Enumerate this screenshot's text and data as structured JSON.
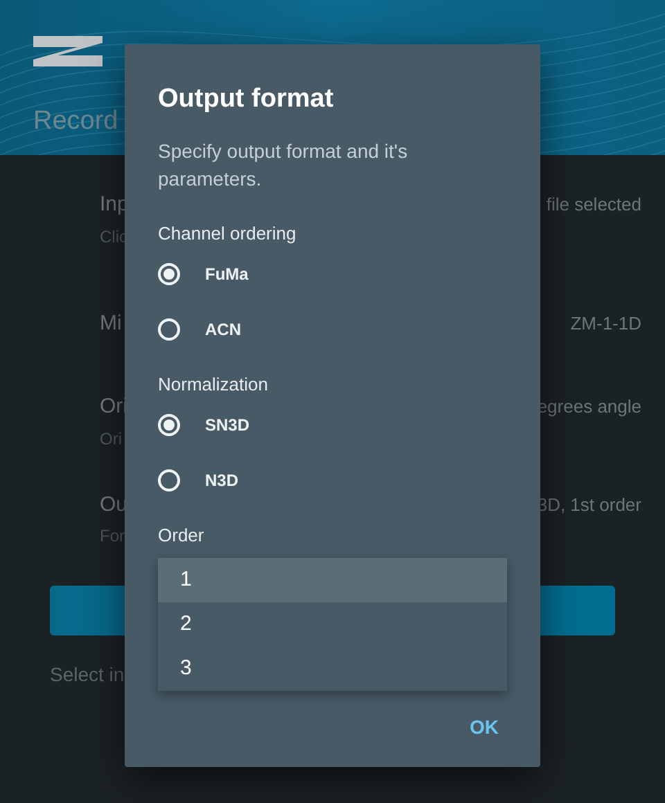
{
  "header": {
    "title": "Record"
  },
  "rows": [
    {
      "label": "Inp",
      "value": "file selected",
      "sub": "Clic"
    },
    {
      "label": "Mi",
      "value": "ZM-1-1D"
    },
    {
      "label": "Ori",
      "value": "egrees angle",
      "sub": "Ori"
    },
    {
      "label": "Ou",
      "value": "3D, 1st order",
      "sub": "For"
    }
  ],
  "hint": "Select in",
  "dialog": {
    "title": "Output format",
    "description": "Specify output format and it's parameters.",
    "groups": [
      {
        "label": "Channel ordering",
        "options": [
          {
            "label": "FuMa",
            "selected": true
          },
          {
            "label": "ACN",
            "selected": false
          }
        ]
      },
      {
        "label": "Normalization",
        "options": [
          {
            "label": "SN3D",
            "selected": true
          },
          {
            "label": "N3D",
            "selected": false
          }
        ]
      }
    ],
    "order": {
      "label": "Order",
      "options": [
        {
          "label": "1",
          "selected": true
        },
        {
          "label": "2",
          "selected": false
        },
        {
          "label": "3",
          "selected": false
        }
      ]
    },
    "ok": "OK"
  }
}
